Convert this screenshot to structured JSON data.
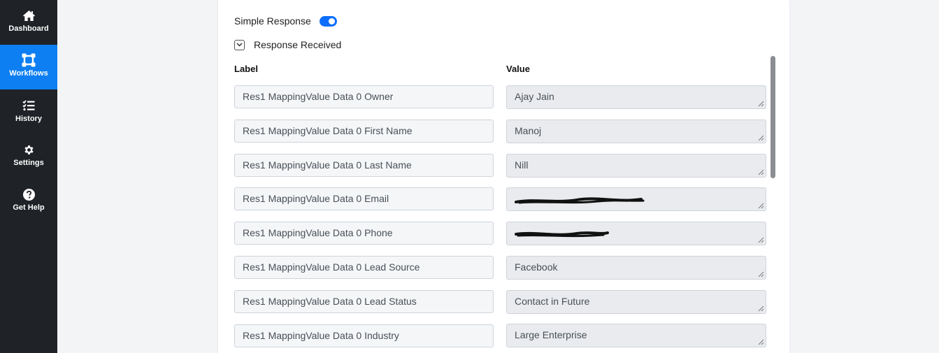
{
  "sidebar": {
    "items": [
      {
        "label": "Dashboard",
        "icon": "home-icon",
        "active": false
      },
      {
        "label": "Workflows",
        "icon": "workflow-icon",
        "active": true
      },
      {
        "label": "History",
        "icon": "checklist-icon",
        "active": false
      },
      {
        "label": "Settings",
        "icon": "gear-icon",
        "active": false
      },
      {
        "label": "Get Help",
        "icon": "question-icon",
        "active": false
      }
    ]
  },
  "response": {
    "simple_label": "Simple Response",
    "simple_enabled": true,
    "received_label": "Response Received",
    "col_label": "Label",
    "col_value": "Value",
    "rows": [
      {
        "label": "Res1 MappingValue Data 0 Owner",
        "value": "Ajay Jain"
      },
      {
        "label": "Res1 MappingValue Data 0 First Name",
        "value": "Manoj"
      },
      {
        "label": "Res1 MappingValue Data 0 Last Name",
        "value": "Nill"
      },
      {
        "label": "Res1 MappingValue Data 0 Email",
        "value": ""
      },
      {
        "label": "Res1 MappingValue Data 0 Phone",
        "value": ""
      },
      {
        "label": "Res1 MappingValue Data 0 Lead Source",
        "value": "Facebook"
      },
      {
        "label": "Res1 MappingValue Data 0 Lead Status",
        "value": "Contact in Future"
      },
      {
        "label": "Res1 MappingValue Data 0 Industry",
        "value": "Large Enterprise"
      }
    ]
  },
  "colors": {
    "accent": "#0d7ff2",
    "sidebar_bg": "#1f2227",
    "toggle_on": "#0d6efd"
  }
}
